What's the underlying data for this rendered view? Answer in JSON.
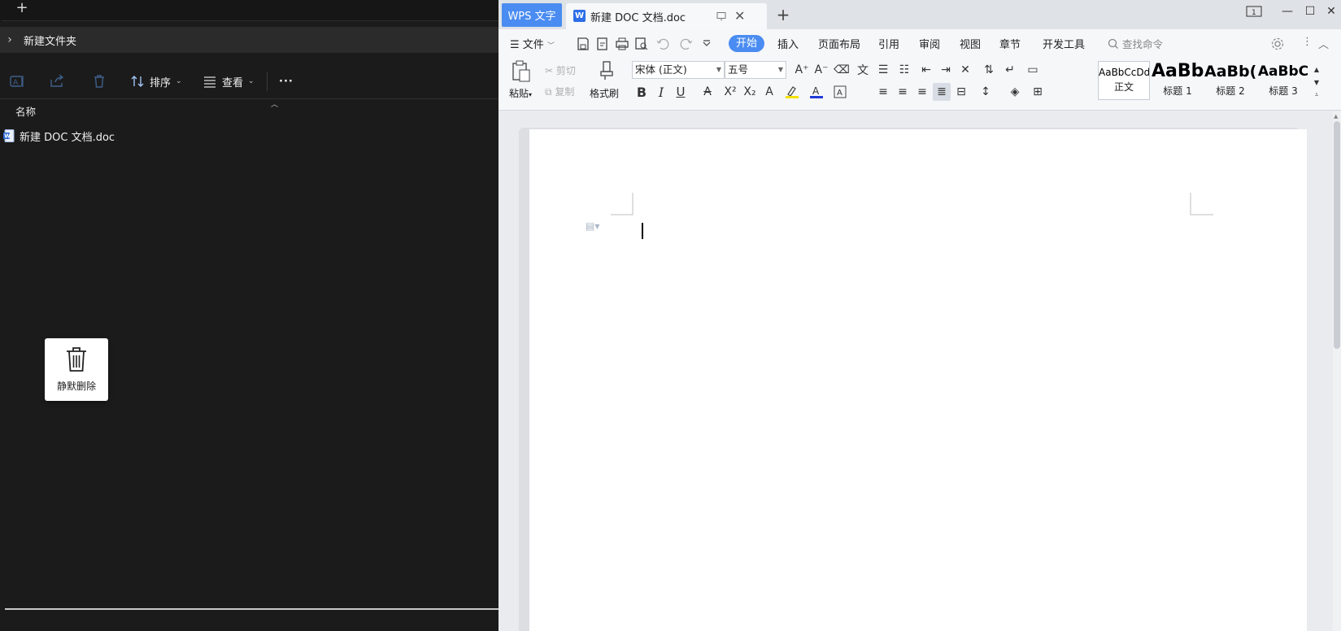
{
  "explorer": {
    "new_tab_symbol": "+",
    "breadcrumb": "新建文件夹",
    "toolbar": {
      "sort_label": "排序",
      "view_label": "查看",
      "more_label": "···"
    },
    "column_name": "名称",
    "files": [
      {
        "name": "新建 DOC 文档.doc",
        "icon": "doc-file-icon"
      }
    ],
    "silent_delete_label": "静默删除"
  },
  "wps": {
    "app_tab_label": "WPS 文字",
    "doc_tab_title": "新建 DOC 文档.doc",
    "window_badge": "1",
    "menu": {
      "file_label": "文件",
      "tabs": [
        "开始",
        "插入",
        "页面布局",
        "引用",
        "审阅",
        "视图",
        "章节",
        "开发工具"
      ],
      "search_placeholder": "查找命令"
    },
    "ribbon": {
      "paste_label": "粘贴",
      "cut_label": "剪切",
      "copy_label": "复制",
      "format_painter_label": "格式刷",
      "font_name": "宋体 (正文)",
      "font_size": "五号",
      "styles": [
        {
          "preview": "AaBbCcDd",
          "name": "正文"
        },
        {
          "preview": "AaBb",
          "name": "标题 1"
        },
        {
          "preview": "AaBb(",
          "name": "标题 2"
        },
        {
          "preview": "AaBbC",
          "name": "标题 3"
        }
      ]
    },
    "accent_color": "#4a8cf1"
  }
}
